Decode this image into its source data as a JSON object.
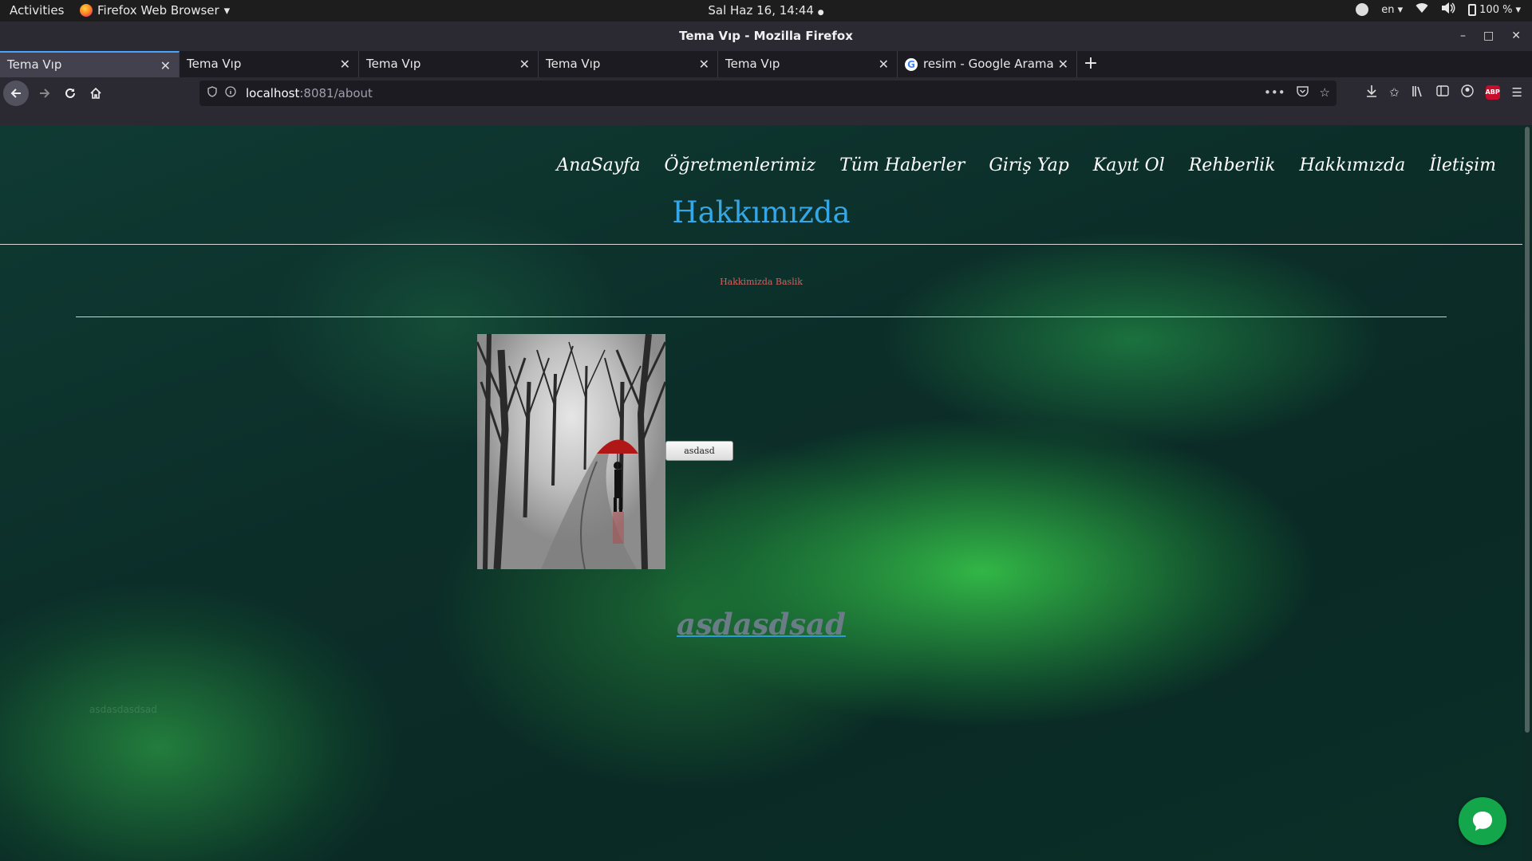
{
  "system_bar": {
    "activities": "Activities",
    "app_menu": "Firefox Web Browser",
    "app_menu_arrow": "▾",
    "clock": "Sal Haz 16, 14:44",
    "clock_dot": "●",
    "language": "en",
    "battery": "100 %",
    "icons": [
      "accessibility-icon",
      "wifi-icon",
      "volume-icon",
      "battery-icon"
    ]
  },
  "window": {
    "title": "Tema Vıp - Mozilla Firefox",
    "minimize": "–",
    "maximize": "□",
    "close": "✕"
  },
  "tabs": [
    {
      "label": "Tema Vıp",
      "active": true
    },
    {
      "label": "Tema Vıp",
      "active": false
    },
    {
      "label": "Tema Vıp",
      "active": false
    },
    {
      "label": "Tema Vıp",
      "active": false
    },
    {
      "label": "Tema Vıp",
      "active": false
    },
    {
      "label": "resim - Google Arama",
      "active": false,
      "favicon": "G"
    }
  ],
  "tab_close": "✕",
  "new_tab": "+",
  "toolbar": {
    "url_host": "localhost",
    "url_rest": ":8081/about",
    "abp_badge": "ABP",
    "icons": [
      "back-icon",
      "forward-icon",
      "reload-icon",
      "home-icon",
      "shield-icon",
      "info-icon",
      "more-icon",
      "pocket-icon",
      "bookmark-star-icon",
      "download-icon",
      "bookmarks-icon",
      "library-icon",
      "sidebar-icon",
      "account-icon",
      "adblock-icon",
      "hamburger-menu-icon"
    ]
  },
  "site": {
    "nav": [
      "AnaSayfa",
      "Öğretmenlerimiz",
      "Tüm Haberler",
      "Giriş Yap",
      "Kayıt Ol",
      "Rehberlik",
      "Hakkımızda",
      "İletişim"
    ],
    "page_title": "Hakkımızda",
    "subtitle": "Hakkimizda Baslik",
    "image_button": "asdasd",
    "big_link": "asdasdsad",
    "faint_text": "asdasdasdsad"
  },
  "colors": {
    "title_blue": "#35a7e6",
    "subtitle_red": "#d4605e",
    "chat_green": "#14a64b",
    "tab_highlight": "#4aa3ff"
  }
}
